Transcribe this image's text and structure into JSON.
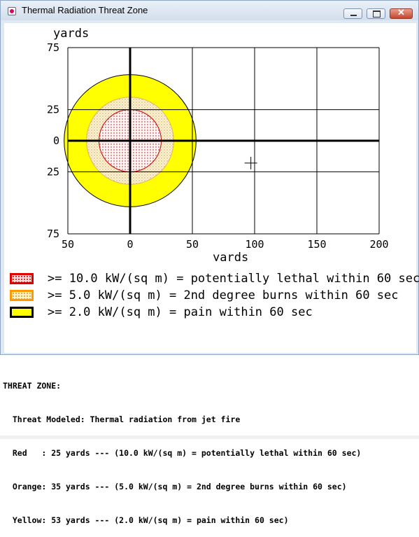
{
  "window": {
    "title": "Thermal Radiation Threat Zone"
  },
  "chart_data": {
    "type": "threat-zone",
    "y_unit_label": "yards",
    "x_unit_label": "yards",
    "x_ticks": [
      "50",
      "0",
      "50",
      "100",
      "150",
      "200"
    ],
    "x_tick_values": [
      -50,
      0,
      50,
      100,
      150,
      200
    ],
    "y_ticks": [
      "75",
      "25",
      "0",
      "25",
      "75"
    ],
    "y_tick_values": [
      75,
      25,
      0,
      -25,
      -75
    ],
    "xlim": [
      -50,
      200
    ],
    "ylim": [
      -75,
      75
    ],
    "grid": true,
    "zones": [
      {
        "name": "Red",
        "radius": 25,
        "color": "#e00000",
        "fill": "#ffc0c0",
        "pattern": "dots"
      },
      {
        "name": "Orange",
        "radius": 35,
        "color": "#f0a000",
        "fill": "#f5e6b0",
        "pattern": "dots"
      },
      {
        "name": "Yellow",
        "radius": 53,
        "color": "#ffff00",
        "fill": "#ffff00",
        "pattern": "solid"
      }
    ],
    "cursor": {
      "x": 97,
      "y": -18
    }
  },
  "legend": [
    {
      "text": ">= 10.0 kW/(sq m) = potentially lethal within 60 sec",
      "border": "#e00000",
      "fill": "#ffd8d8"
    },
    {
      "text": ">= 5.0 kW/(sq m) = 2nd degree burns within 60 sec",
      "border": "#ff9900",
      "fill": "#fff0c0"
    },
    {
      "text": ">= 2.0 kW/(sq m) = pain within 60 sec",
      "border": "#000000",
      "fill": "#ffff00"
    }
  ],
  "info": {
    "heading": "THREAT ZONE:",
    "model": "  Threat Modeled: Thermal radiation from jet fire",
    "red": "  Red   : 25 yards --- (10.0 kW/(sq m) = potentially lethal within 60 sec)",
    "orange": "  Orange: 35 yards --- (5.0 kW/(sq m) = 2nd degree burns within 60 sec)",
    "yellow": "  Yellow: 53 yards --- (2.0 kW/(sq m) = pain within 60 sec)"
  }
}
